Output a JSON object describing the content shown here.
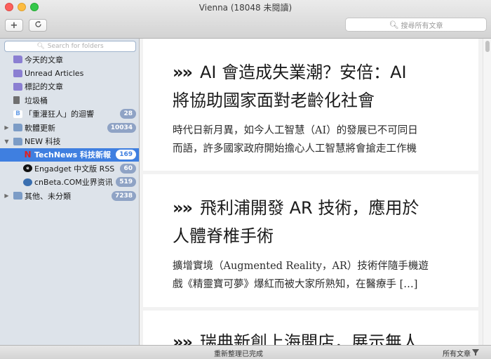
{
  "window": {
    "title": "Vienna (18048 未閱讀)"
  },
  "toolbar": {
    "add_icon": "plus-icon",
    "refresh_icon": "refresh-icon",
    "search_placeholder": "搜尋所有文章"
  },
  "sidebar": {
    "search_placeholder": "Search for folders",
    "items": [
      {
        "label": "今天的文章",
        "icon": "smart-folder-icon",
        "badge": "",
        "indent": 0,
        "disclosure": "",
        "selected": false
      },
      {
        "label": "Unread Articles",
        "icon": "smart-folder-icon",
        "badge": "",
        "indent": 0,
        "disclosure": "",
        "selected": false
      },
      {
        "label": "標記的文章",
        "icon": "smart-folder-icon",
        "badge": "",
        "indent": 0,
        "disclosure": "",
        "selected": false
      },
      {
        "label": "垃圾桶",
        "icon": "trash-icon",
        "badge": "",
        "indent": 0,
        "disclosure": "",
        "selected": false
      },
      {
        "label": "「重灌狂人」的迴響",
        "icon": "blogger-icon",
        "badge": "28",
        "indent": 0,
        "disclosure": "",
        "selected": false
      },
      {
        "label": "軟體更新",
        "icon": "folder-icon",
        "badge": "10034",
        "indent": 0,
        "disclosure": "right",
        "selected": false
      },
      {
        "label": "NEW 科技",
        "icon": "folder-icon",
        "badge": "",
        "indent": 0,
        "disclosure": "down",
        "selected": false
      },
      {
        "label": "TechNews 科技新報",
        "icon": "technews-icon",
        "badge": "169",
        "indent": 1,
        "disclosure": "",
        "selected": true
      },
      {
        "label": "Engadget 中文版 RSS Fe",
        "icon": "engadget-icon",
        "badge": "60",
        "indent": 1,
        "disclosure": "",
        "selected": false
      },
      {
        "label": "cnBeta.COM业界资讯",
        "icon": "cnbeta-icon",
        "badge": "519",
        "indent": 1,
        "disclosure": "",
        "selected": false
      },
      {
        "label": "其他、未分類",
        "icon": "folder-icon",
        "badge": "7238",
        "indent": 0,
        "disclosure": "right",
        "selected": false
      }
    ]
  },
  "articles": [
    {
      "title": "AI 會造成失業潮？安倍：AI 將協助國家面對老齡化社會",
      "title_lines": [
        "AI 會造成失業潮？安倍：AI",
        "將協助國家面對老齡化社會"
      ],
      "summary_lines": [
        "時代日新月異，如今人工智慧（AI）的發展已不可同日",
        "而語，許多國家政府開始擔心人工智慧將會搶走工作機"
      ]
    },
    {
      "title": "飛利浦開發 AR 技術，應用於人體脊椎手術",
      "title_lines": [
        "飛利浦開發 AR 技術，應用於",
        "人體脊椎手術"
      ],
      "summary_lines": [
        "擴增實境（Augmented Reality，AR）技術伴隨手機遊",
        "戲《精靈寶可夢》爆紅而被大家所熟知，在醫療手 […]"
      ]
    },
    {
      "title": "瑞典新創上海開店，展示無人",
      "title_lines": [
        "瑞典新創上海開店，展示無人"
      ],
      "summary_lines": []
    }
  ],
  "article_marker": "»»",
  "status_bar": {
    "message": "重新整理已完成",
    "filter_label": "所有文章",
    "filter_icon": "funnel-icon"
  },
  "colors": {
    "selection": "#3f7fe0",
    "badge": "#8fa3c5",
    "sidebar_bg": "#dde3ea"
  }
}
